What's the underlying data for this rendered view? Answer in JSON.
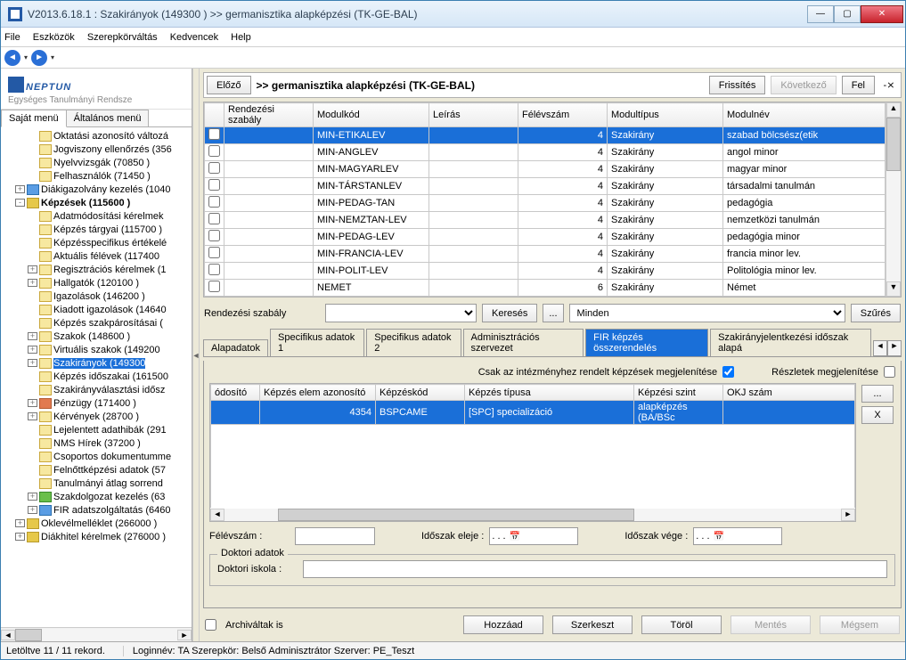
{
  "window": {
    "title": "V2013.6.18.1 : Szakirányok (149300  )  >> germanisztika alapképzési (TK-GE-BAL)"
  },
  "menu": {
    "file": "File",
    "tools": "Eszközök",
    "role": "Szerepkörváltás",
    "fav": "Kedvencek",
    "help": "Help"
  },
  "logo": {
    "brand": "NEPTUN",
    "tagline": "Egységes Tanulmányi Rendsze"
  },
  "leftTabs": {
    "own": "Saját menü",
    "general": "Általános menü"
  },
  "tree": [
    {
      "d": 2,
      "e": "",
      "ic": "ic-doc",
      "t": "Oktatási azonosító változá"
    },
    {
      "d": 2,
      "e": "",
      "ic": "ic-doc",
      "t": "Jogviszony ellenőrzés (356"
    },
    {
      "d": 2,
      "e": "",
      "ic": "ic-doc",
      "t": "Nyelvvizsgák (70850  )"
    },
    {
      "d": 2,
      "e": "",
      "ic": "ic-doc",
      "t": "Felhasználók (71450  )"
    },
    {
      "d": 1,
      "e": "+",
      "ic": "ic-blue",
      "t": "Diákigazolvány kezelés (1040"
    },
    {
      "d": 1,
      "e": "-",
      "ic": "ic-folder",
      "t": "Képzések (115600  )",
      "bold": true
    },
    {
      "d": 2,
      "e": "",
      "ic": "ic-doc",
      "t": "Adatmódosítási kérelmek"
    },
    {
      "d": 2,
      "e": "",
      "ic": "ic-doc",
      "t": "Képzés tárgyai (115700  )"
    },
    {
      "d": 2,
      "e": "",
      "ic": "ic-doc",
      "t": "Képzésspecifikus értékelé"
    },
    {
      "d": 2,
      "e": "",
      "ic": "ic-doc",
      "t": "Aktuális félévek (117400"
    },
    {
      "d": 2,
      "e": "+",
      "ic": "ic-doc",
      "t": "Regisztrációs kérelmek (1"
    },
    {
      "d": 2,
      "e": "+",
      "ic": "ic-doc",
      "t": "Hallgatók (120100  )"
    },
    {
      "d": 2,
      "e": "",
      "ic": "ic-doc",
      "t": "Igazolások (146200  )"
    },
    {
      "d": 2,
      "e": "",
      "ic": "ic-doc",
      "t": "Kiadott igazolások (14640"
    },
    {
      "d": 2,
      "e": "",
      "ic": "ic-doc",
      "t": "Képzés szakpárosításai ("
    },
    {
      "d": 2,
      "e": "+",
      "ic": "ic-doc",
      "t": "Szakok (148600  )"
    },
    {
      "d": 2,
      "e": "+",
      "ic": "ic-doc",
      "t": "Virtuális szakok (149200"
    },
    {
      "d": 2,
      "e": "+",
      "ic": "ic-doc",
      "t": "Szakirányok (149300",
      "sel": true
    },
    {
      "d": 2,
      "e": "",
      "ic": "ic-doc",
      "t": "Képzés időszakai (161500"
    },
    {
      "d": 2,
      "e": "",
      "ic": "ic-doc",
      "t": "Szakirányválasztási idősz"
    },
    {
      "d": 2,
      "e": "+",
      "ic": "ic-red",
      "t": "Pénzügy (171400  )"
    },
    {
      "d": 2,
      "e": "+",
      "ic": "ic-doc",
      "t": "Kérvények (28700  )"
    },
    {
      "d": 2,
      "e": "",
      "ic": "ic-doc",
      "t": "Lejelentett adathibák (291"
    },
    {
      "d": 2,
      "e": "",
      "ic": "ic-doc",
      "t": "NMS Hírek (37200  )"
    },
    {
      "d": 2,
      "e": "",
      "ic": "ic-doc",
      "t": "Csoportos dokumentumme"
    },
    {
      "d": 2,
      "e": "",
      "ic": "ic-doc",
      "t": "Felnőttképzési adatok (57"
    },
    {
      "d": 2,
      "e": "",
      "ic": "ic-doc",
      "t": "Tanulmányi átlag sorrend"
    },
    {
      "d": 2,
      "e": "+",
      "ic": "ic-green",
      "t": "Szakdolgozat kezelés (63"
    },
    {
      "d": 2,
      "e": "+",
      "ic": "ic-blue",
      "t": "FIR adatszolgáltatás (6460"
    },
    {
      "d": 1,
      "e": "+",
      "ic": "ic-folder",
      "t": "Oklevélmelléklet (266000  )"
    },
    {
      "d": 1,
      "e": "+",
      "ic": "ic-folder",
      "t": "Diákhitel kérelmek (276000  )"
    }
  ],
  "hdr": {
    "prev": "Előző",
    "crumb": ">> germanisztika alapképzési (TK-GE-BAL)",
    "refresh": "Frissítés",
    "next": "Következő",
    "up": "Fel",
    "pin": "-⨯"
  },
  "gridCols": {
    "rule": "Rendezési szabály",
    "code": "Modulkód",
    "desc": "Leírás",
    "sem": "Félévszám",
    "type": "Modultípus",
    "name": "Modulnév"
  },
  "gridRows": [
    {
      "code": "MIN-ETIKALEV",
      "sem": "4",
      "type": "Szakirány",
      "name": "szabad bölcsész(etik",
      "sel": true
    },
    {
      "code": "MIN-ANGLEV",
      "sem": "4",
      "type": "Szakirány",
      "name": "angol minor"
    },
    {
      "code": "MIN-MAGYARLEV",
      "sem": "4",
      "type": "Szakirány",
      "name": "magyar minor"
    },
    {
      "code": "MIN-TÁRSTANLEV",
      "sem": "4",
      "type": "Szakirány",
      "name": "társadalmi tanulmán"
    },
    {
      "code": "MIN-PEDAG-TAN",
      "sem": "4",
      "type": "Szakirány",
      "name": "pedagógia"
    },
    {
      "code": "MIN-NEMZTAN-LEV",
      "sem": "4",
      "type": "Szakirány",
      "name": "nemzetközi tanulmán"
    },
    {
      "code": "MIN-PEDAG-LEV",
      "sem": "4",
      "type": "Szakirány",
      "name": "pedagógia minor"
    },
    {
      "code": "MIN-FRANCIA-LEV",
      "sem": "4",
      "type": "Szakirány",
      "name": "francia minor lev."
    },
    {
      "code": "MIN-POLIT-LEV",
      "sem": "4",
      "type": "Szakirány",
      "name": "Politológia minor lev."
    },
    {
      "code": "NEMET",
      "sem": "6",
      "type": "Szakirány",
      "name": "Német"
    }
  ],
  "filter": {
    "label": "Rendezési szabály",
    "search": "Keresés",
    "all": "Minden",
    "btn": "Szűrés"
  },
  "tabs": {
    "t1": "Alapadatok",
    "t2": "Specifikus adatok 1",
    "t3": "Specifikus adatok 2",
    "t4": "Adminisztrációs szervezet",
    "t5": "FIR képzés összerendelés",
    "t6": "Szakirányjelentkezési időszak alapá"
  },
  "checks": {
    "inst": "Csak az intézményhez rendelt képzések megjelenítése",
    "details": "Részletek megjelenítése"
  },
  "subCols": {
    "id": "ódosító",
    "elem": "Képzés elem azonosító",
    "code": "Képzéskód",
    "type": "Képzés típusa",
    "level": "Képzési szint",
    "okj": "OKJ szám"
  },
  "subRow": {
    "id": "",
    "elem": "4354",
    "code": "BSPCAME",
    "type": "[SPC] specializáció",
    "level": "alapképzés (BA/BSc",
    "okj": ""
  },
  "sideBtns": {
    "dots": "...",
    "x": "X"
  },
  "form": {
    "sem": "Félévszám :",
    "pstart": "Időszak eleje :",
    "pend": "Időszak vége :",
    "datedots": ".   .   .",
    "fieldset": "Doktori adatok",
    "school": "Doktori iskola :"
  },
  "bottom": {
    "arch": "Archiváltak is",
    "add": "Hozzáad",
    "edit": "Szerkeszt",
    "del": "Töröl",
    "save": "Mentés",
    "cancel": "Mégsem"
  },
  "status": {
    "count": "Letöltve 11 / 11 rekord.",
    "login": "Loginnév: TA   Szerepkör: Belső Adminisztrátor   Szerver: PE_Teszt"
  }
}
